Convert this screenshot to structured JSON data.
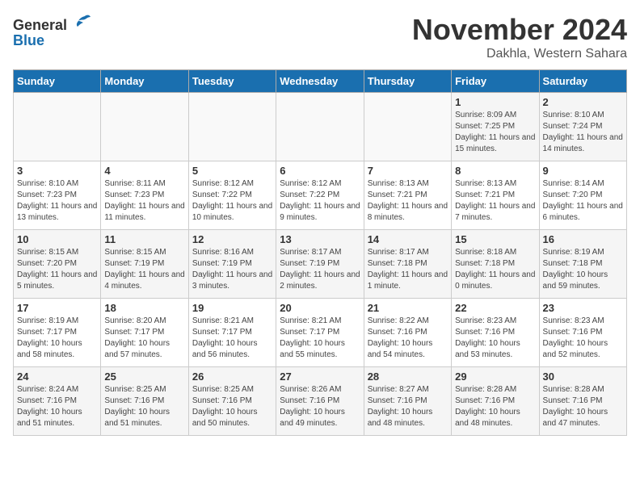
{
  "logo": {
    "general": "General",
    "blue": "Blue"
  },
  "title": "November 2024",
  "location": "Dakhla, Western Sahara",
  "days_of_week": [
    "Sunday",
    "Monday",
    "Tuesday",
    "Wednesday",
    "Thursday",
    "Friday",
    "Saturday"
  ],
  "weeks": [
    [
      {
        "day": "",
        "info": ""
      },
      {
        "day": "",
        "info": ""
      },
      {
        "day": "",
        "info": ""
      },
      {
        "day": "",
        "info": ""
      },
      {
        "day": "",
        "info": ""
      },
      {
        "day": "1",
        "info": "Sunrise: 8:09 AM\nSunset: 7:25 PM\nDaylight: 11 hours and 15 minutes."
      },
      {
        "day": "2",
        "info": "Sunrise: 8:10 AM\nSunset: 7:24 PM\nDaylight: 11 hours and 14 minutes."
      }
    ],
    [
      {
        "day": "3",
        "info": "Sunrise: 8:10 AM\nSunset: 7:23 PM\nDaylight: 11 hours and 13 minutes."
      },
      {
        "day": "4",
        "info": "Sunrise: 8:11 AM\nSunset: 7:23 PM\nDaylight: 11 hours and 11 minutes."
      },
      {
        "day": "5",
        "info": "Sunrise: 8:12 AM\nSunset: 7:22 PM\nDaylight: 11 hours and 10 minutes."
      },
      {
        "day": "6",
        "info": "Sunrise: 8:12 AM\nSunset: 7:22 PM\nDaylight: 11 hours and 9 minutes."
      },
      {
        "day": "7",
        "info": "Sunrise: 8:13 AM\nSunset: 7:21 PM\nDaylight: 11 hours and 8 minutes."
      },
      {
        "day": "8",
        "info": "Sunrise: 8:13 AM\nSunset: 7:21 PM\nDaylight: 11 hours and 7 minutes."
      },
      {
        "day": "9",
        "info": "Sunrise: 8:14 AM\nSunset: 7:20 PM\nDaylight: 11 hours and 6 minutes."
      }
    ],
    [
      {
        "day": "10",
        "info": "Sunrise: 8:15 AM\nSunset: 7:20 PM\nDaylight: 11 hours and 5 minutes."
      },
      {
        "day": "11",
        "info": "Sunrise: 8:15 AM\nSunset: 7:19 PM\nDaylight: 11 hours and 4 minutes."
      },
      {
        "day": "12",
        "info": "Sunrise: 8:16 AM\nSunset: 7:19 PM\nDaylight: 11 hours and 3 minutes."
      },
      {
        "day": "13",
        "info": "Sunrise: 8:17 AM\nSunset: 7:19 PM\nDaylight: 11 hours and 2 minutes."
      },
      {
        "day": "14",
        "info": "Sunrise: 8:17 AM\nSunset: 7:18 PM\nDaylight: 11 hours and 1 minute."
      },
      {
        "day": "15",
        "info": "Sunrise: 8:18 AM\nSunset: 7:18 PM\nDaylight: 11 hours and 0 minutes."
      },
      {
        "day": "16",
        "info": "Sunrise: 8:19 AM\nSunset: 7:18 PM\nDaylight: 10 hours and 59 minutes."
      }
    ],
    [
      {
        "day": "17",
        "info": "Sunrise: 8:19 AM\nSunset: 7:17 PM\nDaylight: 10 hours and 58 minutes."
      },
      {
        "day": "18",
        "info": "Sunrise: 8:20 AM\nSunset: 7:17 PM\nDaylight: 10 hours and 57 minutes."
      },
      {
        "day": "19",
        "info": "Sunrise: 8:21 AM\nSunset: 7:17 PM\nDaylight: 10 hours and 56 minutes."
      },
      {
        "day": "20",
        "info": "Sunrise: 8:21 AM\nSunset: 7:17 PM\nDaylight: 10 hours and 55 minutes."
      },
      {
        "day": "21",
        "info": "Sunrise: 8:22 AM\nSunset: 7:16 PM\nDaylight: 10 hours and 54 minutes."
      },
      {
        "day": "22",
        "info": "Sunrise: 8:23 AM\nSunset: 7:16 PM\nDaylight: 10 hours and 53 minutes."
      },
      {
        "day": "23",
        "info": "Sunrise: 8:23 AM\nSunset: 7:16 PM\nDaylight: 10 hours and 52 minutes."
      }
    ],
    [
      {
        "day": "24",
        "info": "Sunrise: 8:24 AM\nSunset: 7:16 PM\nDaylight: 10 hours and 51 minutes."
      },
      {
        "day": "25",
        "info": "Sunrise: 8:25 AM\nSunset: 7:16 PM\nDaylight: 10 hours and 51 minutes."
      },
      {
        "day": "26",
        "info": "Sunrise: 8:25 AM\nSunset: 7:16 PM\nDaylight: 10 hours and 50 minutes."
      },
      {
        "day": "27",
        "info": "Sunrise: 8:26 AM\nSunset: 7:16 PM\nDaylight: 10 hours and 49 minutes."
      },
      {
        "day": "28",
        "info": "Sunrise: 8:27 AM\nSunset: 7:16 PM\nDaylight: 10 hours and 48 minutes."
      },
      {
        "day": "29",
        "info": "Sunrise: 8:28 AM\nSunset: 7:16 PM\nDaylight: 10 hours and 48 minutes."
      },
      {
        "day": "30",
        "info": "Sunrise: 8:28 AM\nSunset: 7:16 PM\nDaylight: 10 hours and 47 minutes."
      }
    ]
  ]
}
